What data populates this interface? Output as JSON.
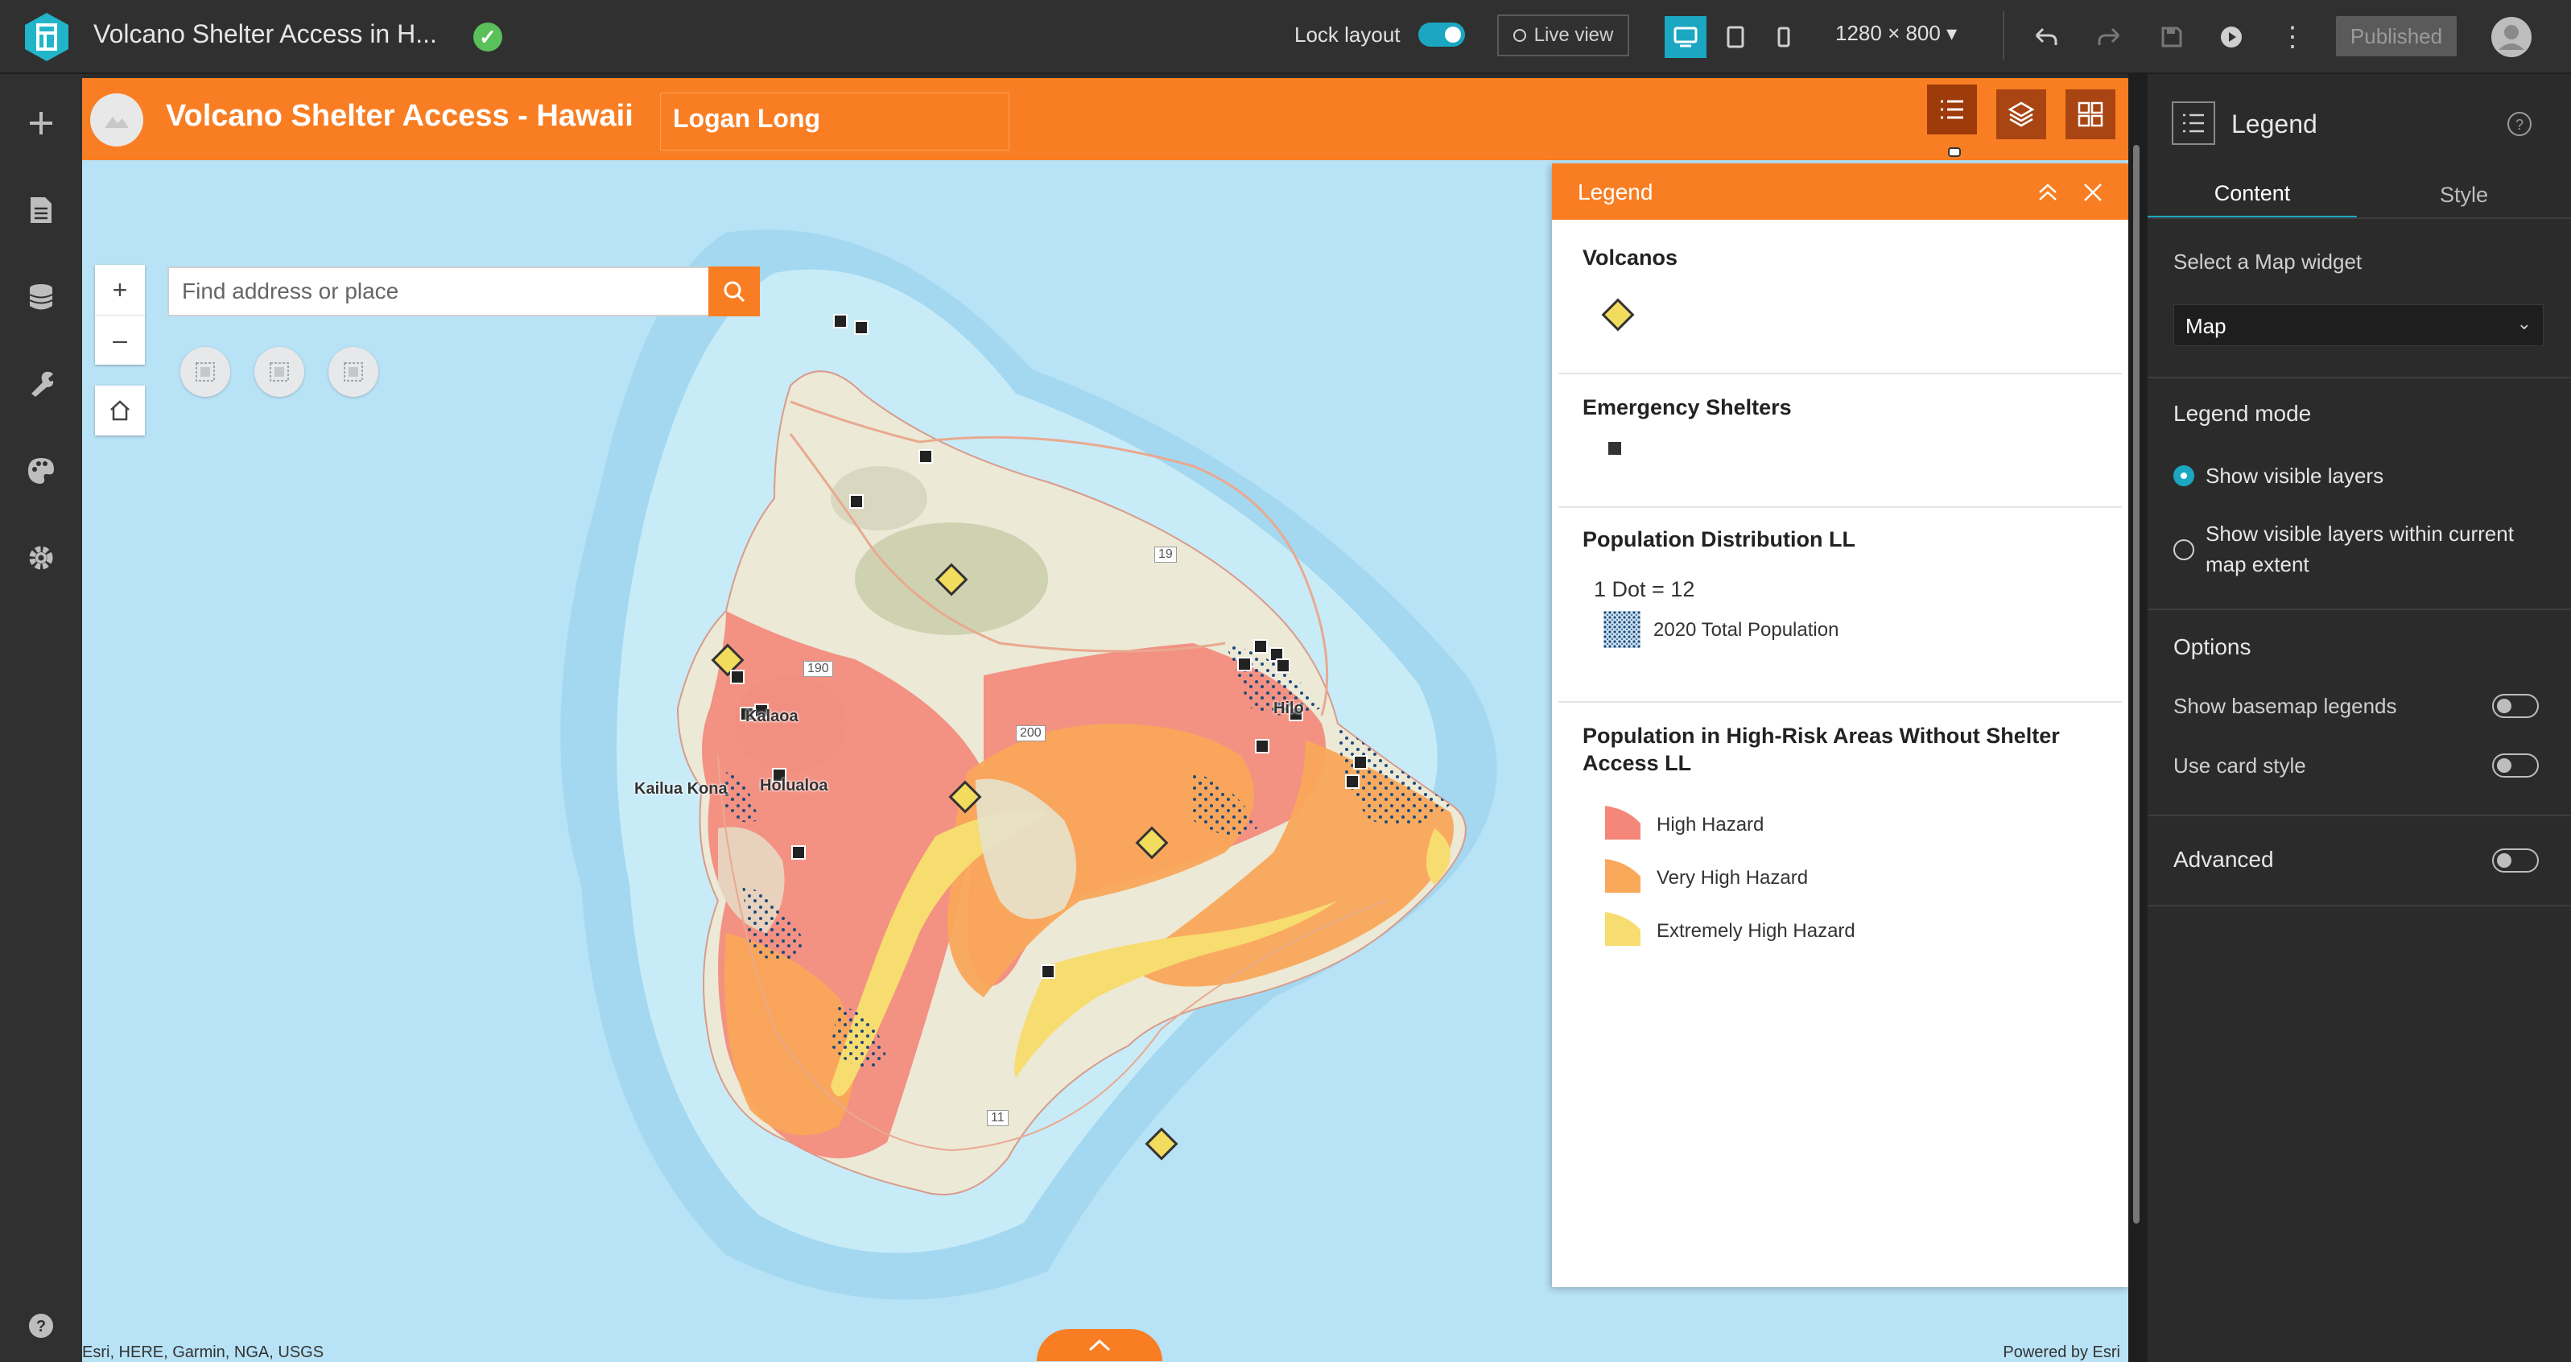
{
  "topbar": {
    "app_title": "Volcano Shelter Access in H...",
    "lock_layout_label": "Lock layout",
    "live_view_label": "Live view",
    "resolution": "1280 × 800",
    "published_label": "Published"
  },
  "header": {
    "title": "Volcano Shelter Access - Hawaii",
    "subtitle": "Logan Long"
  },
  "map": {
    "search_placeholder": "Find address or place",
    "zoom_in": "+",
    "zoom_out": "–",
    "place_labels": {
      "kalaoa": "Kalaoa",
      "kailua_kona": "Kailua Kona",
      "holualoa": "Holualoa",
      "hilo": "Hilo"
    },
    "road_labels": {
      "r19": "19",
      "r190": "190",
      "r200": "200",
      "r11": "11"
    },
    "attribution": "Esri, HERE, Garmin, NGA, USGS",
    "powered_by": "Powered by Esri"
  },
  "legend": {
    "panel_title": "Legend",
    "volcanos_title": "Volcanos",
    "shelters_title": "Emergency Shelters",
    "population_title": "Population Distribution LL",
    "dot_ratio": "1 Dot = 12",
    "population_item": "2020 Total Population",
    "risk_title": "Population in High-Risk Areas Without Shelter Access LL",
    "risk_items": [
      "High Hazard",
      "Very High Hazard",
      "Extremely High Hazard"
    ],
    "colors": {
      "high": "#f4877a",
      "very_high": "#f9a85a",
      "extreme": "#f7dc6f",
      "volcano": "#f2dc5d",
      "accent": "#f97e23"
    }
  },
  "settings": {
    "title": "Legend",
    "tabs": [
      "Content",
      "Style"
    ],
    "select_widget_label": "Select a Map widget",
    "select_widget_value": "Map",
    "legend_mode_label": "Legend mode",
    "mode_options": [
      "Show visible layers",
      "Show visible layers within current map extent"
    ],
    "options_label": "Options",
    "option_basemap": "Show basemap legends",
    "option_card": "Use card style",
    "advanced_label": "Advanced"
  }
}
